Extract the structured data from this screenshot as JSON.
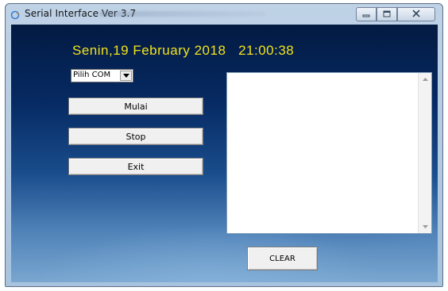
{
  "window": {
    "title": "Serial Interface Ver 3.7",
    "icons": {
      "app": "refresh-circle-icon",
      "minimize": "minimize-icon",
      "maximize": "maximize-icon",
      "close": "close-icon"
    }
  },
  "main": {
    "datetime": "Senin,19 February 2018   21:00:38",
    "com_select": {
      "value": "Pilih COM",
      "arrow_icon": "chevron-down-icon"
    },
    "buttons": {
      "start": "Mulai",
      "stop": "Stop",
      "exit": "Exit",
      "clear": "CLEAR"
    },
    "output_text": ""
  },
  "colors": {
    "datetime": "#f3e31b",
    "background_top": "#031a42",
    "background_bottom": "#7aa6d0"
  }
}
